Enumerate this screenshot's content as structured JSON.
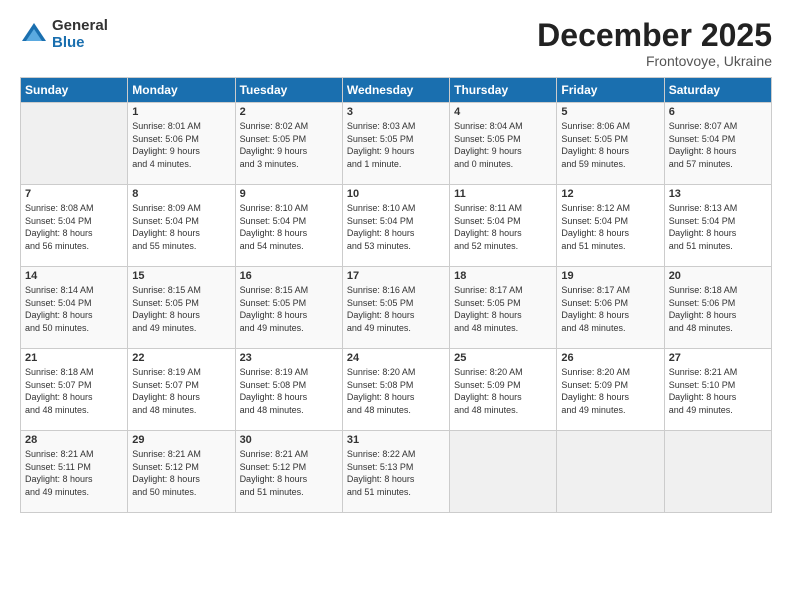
{
  "logo": {
    "general": "General",
    "blue": "Blue"
  },
  "title": "December 2025",
  "subtitle": "Frontovoye, Ukraine",
  "days_header": [
    "Sunday",
    "Monday",
    "Tuesday",
    "Wednesday",
    "Thursday",
    "Friday",
    "Saturday"
  ],
  "weeks": [
    [
      {
        "day": "",
        "info": ""
      },
      {
        "day": "1",
        "info": "Sunrise: 8:01 AM\nSunset: 5:06 PM\nDaylight: 9 hours\nand 4 minutes."
      },
      {
        "day": "2",
        "info": "Sunrise: 8:02 AM\nSunset: 5:05 PM\nDaylight: 9 hours\nand 3 minutes."
      },
      {
        "day": "3",
        "info": "Sunrise: 8:03 AM\nSunset: 5:05 PM\nDaylight: 9 hours\nand 1 minute."
      },
      {
        "day": "4",
        "info": "Sunrise: 8:04 AM\nSunset: 5:05 PM\nDaylight: 9 hours\nand 0 minutes."
      },
      {
        "day": "5",
        "info": "Sunrise: 8:06 AM\nSunset: 5:05 PM\nDaylight: 8 hours\nand 59 minutes."
      },
      {
        "day": "6",
        "info": "Sunrise: 8:07 AM\nSunset: 5:04 PM\nDaylight: 8 hours\nand 57 minutes."
      }
    ],
    [
      {
        "day": "7",
        "info": "Sunrise: 8:08 AM\nSunset: 5:04 PM\nDaylight: 8 hours\nand 56 minutes."
      },
      {
        "day": "8",
        "info": "Sunrise: 8:09 AM\nSunset: 5:04 PM\nDaylight: 8 hours\nand 55 minutes."
      },
      {
        "day": "9",
        "info": "Sunrise: 8:10 AM\nSunset: 5:04 PM\nDaylight: 8 hours\nand 54 minutes."
      },
      {
        "day": "10",
        "info": "Sunrise: 8:10 AM\nSunset: 5:04 PM\nDaylight: 8 hours\nand 53 minutes."
      },
      {
        "day": "11",
        "info": "Sunrise: 8:11 AM\nSunset: 5:04 PM\nDaylight: 8 hours\nand 52 minutes."
      },
      {
        "day": "12",
        "info": "Sunrise: 8:12 AM\nSunset: 5:04 PM\nDaylight: 8 hours\nand 51 minutes."
      },
      {
        "day": "13",
        "info": "Sunrise: 8:13 AM\nSunset: 5:04 PM\nDaylight: 8 hours\nand 51 minutes."
      }
    ],
    [
      {
        "day": "14",
        "info": "Sunrise: 8:14 AM\nSunset: 5:04 PM\nDaylight: 8 hours\nand 50 minutes."
      },
      {
        "day": "15",
        "info": "Sunrise: 8:15 AM\nSunset: 5:05 PM\nDaylight: 8 hours\nand 49 minutes."
      },
      {
        "day": "16",
        "info": "Sunrise: 8:15 AM\nSunset: 5:05 PM\nDaylight: 8 hours\nand 49 minutes."
      },
      {
        "day": "17",
        "info": "Sunrise: 8:16 AM\nSunset: 5:05 PM\nDaylight: 8 hours\nand 49 minutes."
      },
      {
        "day": "18",
        "info": "Sunrise: 8:17 AM\nSunset: 5:05 PM\nDaylight: 8 hours\nand 48 minutes."
      },
      {
        "day": "19",
        "info": "Sunrise: 8:17 AM\nSunset: 5:06 PM\nDaylight: 8 hours\nand 48 minutes."
      },
      {
        "day": "20",
        "info": "Sunrise: 8:18 AM\nSunset: 5:06 PM\nDaylight: 8 hours\nand 48 minutes."
      }
    ],
    [
      {
        "day": "21",
        "info": "Sunrise: 8:18 AM\nSunset: 5:07 PM\nDaylight: 8 hours\nand 48 minutes."
      },
      {
        "day": "22",
        "info": "Sunrise: 8:19 AM\nSunset: 5:07 PM\nDaylight: 8 hours\nand 48 minutes."
      },
      {
        "day": "23",
        "info": "Sunrise: 8:19 AM\nSunset: 5:08 PM\nDaylight: 8 hours\nand 48 minutes."
      },
      {
        "day": "24",
        "info": "Sunrise: 8:20 AM\nSunset: 5:08 PM\nDaylight: 8 hours\nand 48 minutes."
      },
      {
        "day": "25",
        "info": "Sunrise: 8:20 AM\nSunset: 5:09 PM\nDaylight: 8 hours\nand 48 minutes."
      },
      {
        "day": "26",
        "info": "Sunrise: 8:20 AM\nSunset: 5:09 PM\nDaylight: 8 hours\nand 49 minutes."
      },
      {
        "day": "27",
        "info": "Sunrise: 8:21 AM\nSunset: 5:10 PM\nDaylight: 8 hours\nand 49 minutes."
      }
    ],
    [
      {
        "day": "28",
        "info": "Sunrise: 8:21 AM\nSunset: 5:11 PM\nDaylight: 8 hours\nand 49 minutes."
      },
      {
        "day": "29",
        "info": "Sunrise: 8:21 AM\nSunset: 5:12 PM\nDaylight: 8 hours\nand 50 minutes."
      },
      {
        "day": "30",
        "info": "Sunrise: 8:21 AM\nSunset: 5:12 PM\nDaylight: 8 hours\nand 51 minutes."
      },
      {
        "day": "31",
        "info": "Sunrise: 8:22 AM\nSunset: 5:13 PM\nDaylight: 8 hours\nand 51 minutes."
      },
      {
        "day": "",
        "info": ""
      },
      {
        "day": "",
        "info": ""
      },
      {
        "day": "",
        "info": ""
      }
    ]
  ]
}
